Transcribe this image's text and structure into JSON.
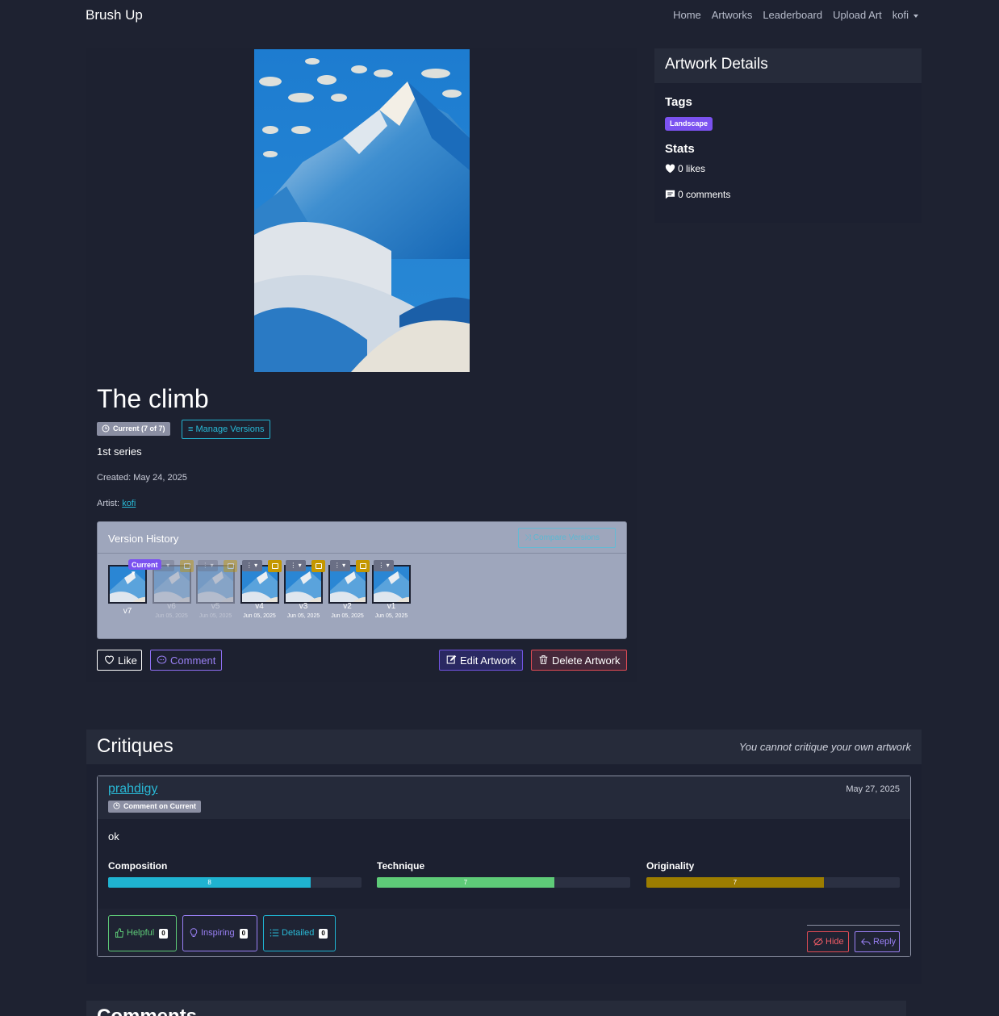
{
  "navbar": {
    "brand": "Brush Up",
    "links": [
      "Home",
      "Artworks",
      "Leaderboard",
      "Upload Art"
    ],
    "user": "kofi"
  },
  "artwork": {
    "title": "The climb",
    "version_badge": "Current (7 of 7)",
    "manage_versions": "Manage Versions",
    "description": "1st series",
    "created_label": "Created:",
    "created": "May 24, 2025",
    "artist_label": "Artist:",
    "artist": "kofi"
  },
  "version_history": {
    "title": "Version History",
    "compare": "Compare Versions",
    "current_pill": "Current",
    "versions": [
      {
        "label": "v7",
        "date": ""
      },
      {
        "label": "v6",
        "date": "Jun 05, 2025"
      },
      {
        "label": "v5",
        "date": "Jun 05, 2025"
      },
      {
        "label": "v4",
        "date": "Jun 05, 2025"
      },
      {
        "label": "v3",
        "date": "Jun 05, 2025"
      },
      {
        "label": "v2",
        "date": "Jun 05, 2025"
      },
      {
        "label": "v1",
        "date": "Jun 05, 2025"
      }
    ]
  },
  "actions": {
    "like": "Like",
    "comment": "Comment",
    "edit": "Edit Artwork",
    "delete": "Delete Artwork"
  },
  "details": {
    "title": "Artwork Details",
    "tags_heading": "Tags",
    "tags": [
      "Landscape"
    ],
    "stats_heading": "Stats",
    "likes": "0 likes",
    "comments": "0 comments"
  },
  "critiques": {
    "title": "Critiques",
    "note": "You cannot critique your own artwork",
    "items": [
      {
        "user": "prahdigy",
        "date": "May 27, 2025",
        "badge": "Comment on Current",
        "text": "ok",
        "metrics": [
          {
            "label": "Composition",
            "value": "8",
            "fraction": 0.8,
            "color": "#1fb3d1"
          },
          {
            "label": "Technique",
            "value": "7",
            "fraction": 0.7,
            "color": "#5ecb78"
          },
          {
            "label": "Originality",
            "value": "7",
            "fraction": 0.7,
            "color": "#9c7d00"
          }
        ],
        "reactions": [
          {
            "label": "Helpful",
            "count": "0"
          },
          {
            "label": "Inspiring",
            "count": "0"
          },
          {
            "label": "Detailed",
            "count": "0"
          }
        ],
        "hide": "Hide",
        "reply": "Reply"
      }
    ]
  },
  "comments": {
    "title": "Comments"
  }
}
